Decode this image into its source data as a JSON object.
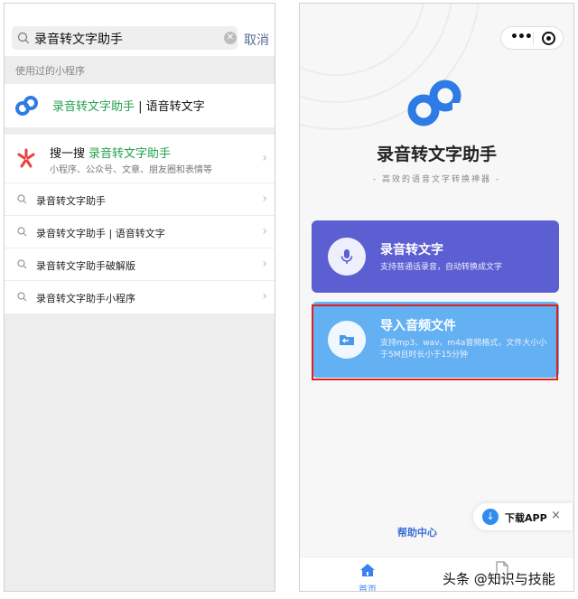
{
  "left": {
    "search": {
      "query": "录音转文字助手",
      "cancel_label": "取消"
    },
    "used_section_label": "使用过的小程序",
    "used_item": {
      "name": "录音转文字助手",
      "separator": " | ",
      "suffix": "语音转文字"
    },
    "sousou": {
      "prefix": "搜一搜",
      "highlight": "录音转文字助手",
      "description": "小程序、公众号、文章、朋友圈和表情等"
    },
    "suggestions": [
      "录音转文字助手",
      "录音转文字助手 | 语音转文字",
      "录音转文字助手破解版",
      "录音转文字助手小程序"
    ]
  },
  "right": {
    "app_title": "录音转文字助手",
    "app_slogan": "- 高效的语音文字转换神器 -",
    "card_record": {
      "title": "录音转文字",
      "description": "支持普通话录音，自动转换成文字"
    },
    "card_import": {
      "title": "导入音频文件",
      "description": "支持mp3、wav、m4a音频格式，文件大小小于5M且时长小于15分钟"
    },
    "download": {
      "label": "下载APP",
      "close": "×"
    },
    "help_label": "帮助中心",
    "tab_home_label": "首页"
  },
  "watermark": "头条 @知识与技能",
  "colors": {
    "wechat_green": "#22a24b",
    "card_purple": "#5c5fd2",
    "card_blue": "#63b1f2",
    "link_blue": "#3b6fd6",
    "highlight_red": "#e02020"
  }
}
